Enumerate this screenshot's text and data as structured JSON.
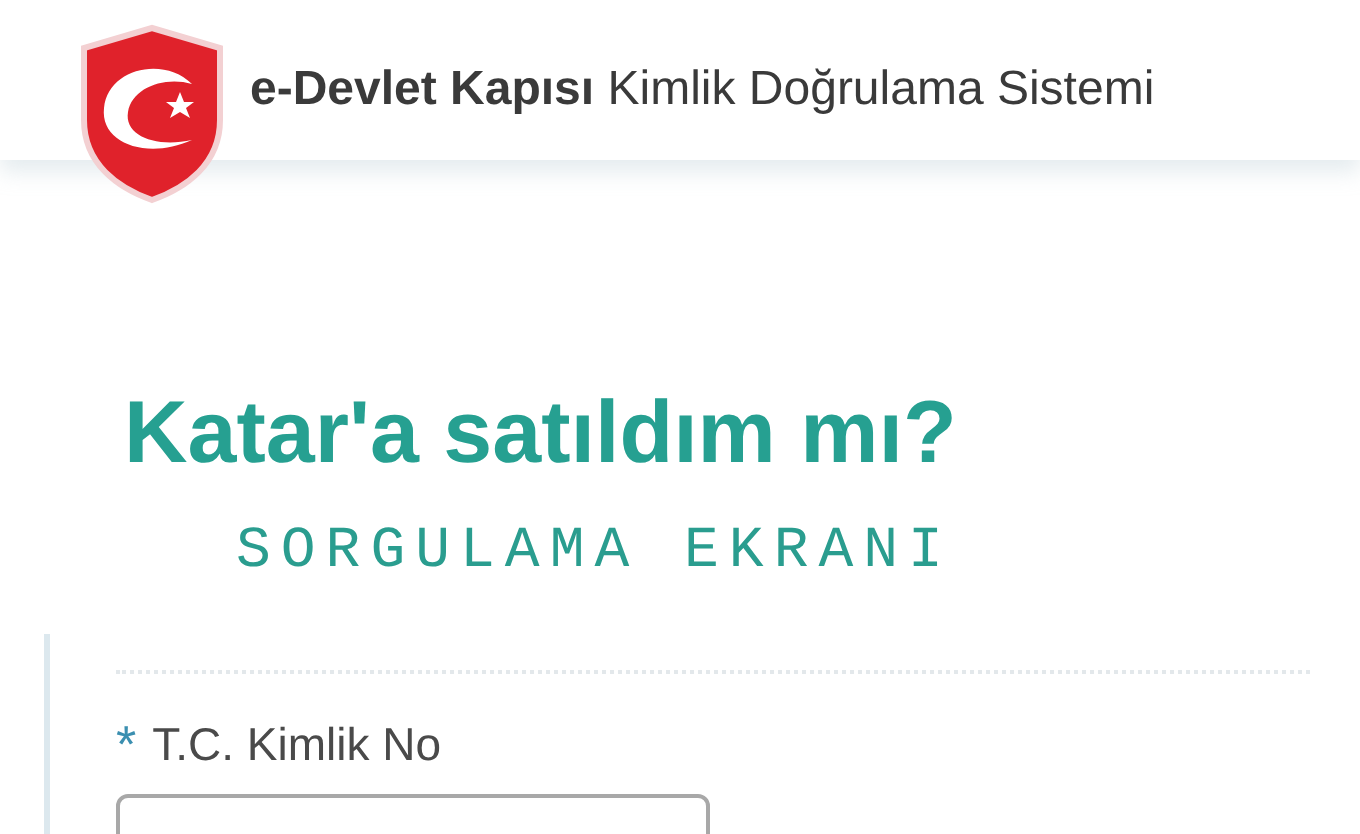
{
  "header": {
    "title": "**e-Devlet Kapısı** Kimlik Doğrulama Sistemi"
  },
  "heading": "Katar'a satıldım mı?",
  "subheading": "SORGULAMA EKRANI",
  "form": {
    "fields": [
      {
        "marker": "*",
        "label": "T.C. Kimlik No"
      }
    ]
  }
}
